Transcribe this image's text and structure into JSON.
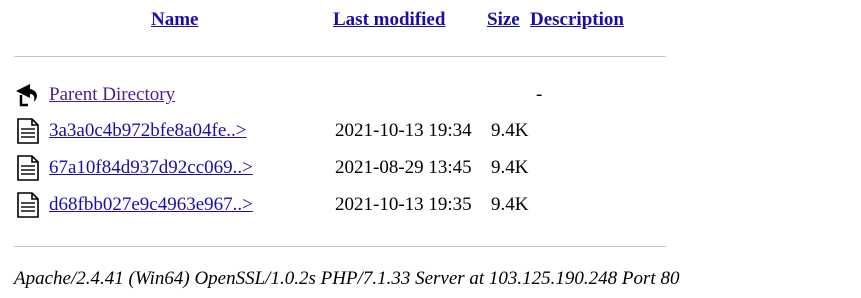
{
  "columns": {
    "name": "Name",
    "last_modified": "Last modified",
    "size": "Size",
    "description": "Description"
  },
  "parent": {
    "label": "Parent Directory",
    "size": "-",
    "icon": "back-arrow-icon"
  },
  "files": [
    {
      "name": "3a3a0c4b972bfe8a04fe..>",
      "modified": "2021-10-13 19:34",
      "size": "9.4K",
      "icon": "file-icon"
    },
    {
      "name": "67a10f84d937d92cc069..>",
      "modified": "2021-08-29 13:45",
      "size": "9.4K",
      "icon": "file-icon"
    },
    {
      "name": "d68fbb027e9c4963e967..>",
      "modified": "2021-10-13 19:35",
      "size": "9.4K",
      "icon": "file-icon"
    }
  ],
  "footer": {
    "signature": "Apache/2.4.41 (Win64) OpenSSL/1.0.2s PHP/7.1.33 Server at 103.125.190.248 Port 80"
  },
  "colors": {
    "link": "#1a0dab",
    "visited_link": "#551a8b",
    "rule": "#c4c4c4"
  }
}
